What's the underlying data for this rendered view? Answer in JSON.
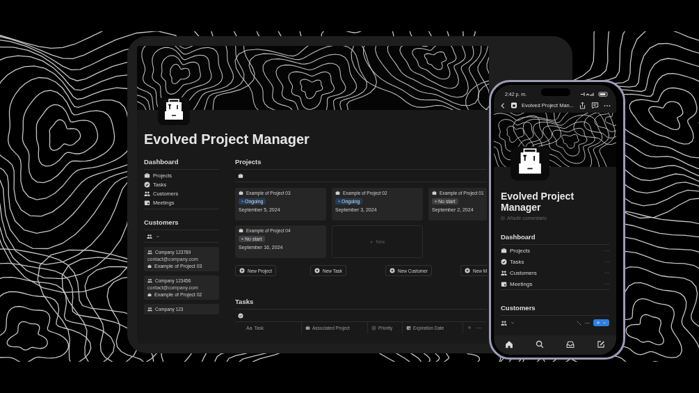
{
  "tablet": {
    "title": "Evolved Project Manager",
    "sidebar": {
      "dashboard_heading": "Dashboard",
      "links": [
        {
          "label": "Projects"
        },
        {
          "label": "Tasks"
        },
        {
          "label": "Customers"
        },
        {
          "label": "Meetings"
        }
      ],
      "customers_heading": "Customers",
      "customers": [
        {
          "name": "Company 123789",
          "email": "contact@company.com",
          "project": "Example of Project 03"
        },
        {
          "name": "Company 123456",
          "email": "contact@company.com",
          "project": "Example of Project 02"
        },
        {
          "name": "Company 123"
        }
      ]
    },
    "projects": {
      "heading": "Projects",
      "cards": [
        {
          "name": "Example of Project 03",
          "status": {
            "label": "Ongoing",
            "color": "#2e7ad1"
          },
          "date": "September 5, 2024"
        },
        {
          "name": "Example of Project 02",
          "status": {
            "label": "Ongoing",
            "color": "#2e7ad1"
          },
          "date": "September 3, 2024"
        },
        {
          "name": "Example of Project 01",
          "status": {
            "label": "No start",
            "color": "#8a8a8a"
          },
          "date": "September 2, 2024"
        },
        {
          "name": "Example of Project 04",
          "status": {
            "label": "No start",
            "color": "#8a8a8a"
          },
          "date": "September 16, 2024"
        }
      ],
      "new_card": "New",
      "buttons": [
        "New Project",
        "New Task",
        "New Customer",
        "New M"
      ]
    },
    "tasks": {
      "heading": "Tasks",
      "columns": [
        {
          "prefix": "Aa",
          "label": "Task"
        },
        {
          "label": "Associated Project"
        },
        {
          "label": "Priority"
        },
        {
          "label": "Expiration Date"
        }
      ]
    }
  },
  "phone": {
    "time": "2:42 p. m.",
    "page_title": "Evolved Project Man...",
    "title": "Evolved Project Manager",
    "comment_placeholder": "Añadir comentario",
    "dashboard_heading": "Dashboard",
    "links": [
      {
        "label": "Projects"
      },
      {
        "label": "Tasks"
      },
      {
        "label": "Customers"
      },
      {
        "label": "Meetings"
      }
    ],
    "customers_heading": "Customers"
  }
}
